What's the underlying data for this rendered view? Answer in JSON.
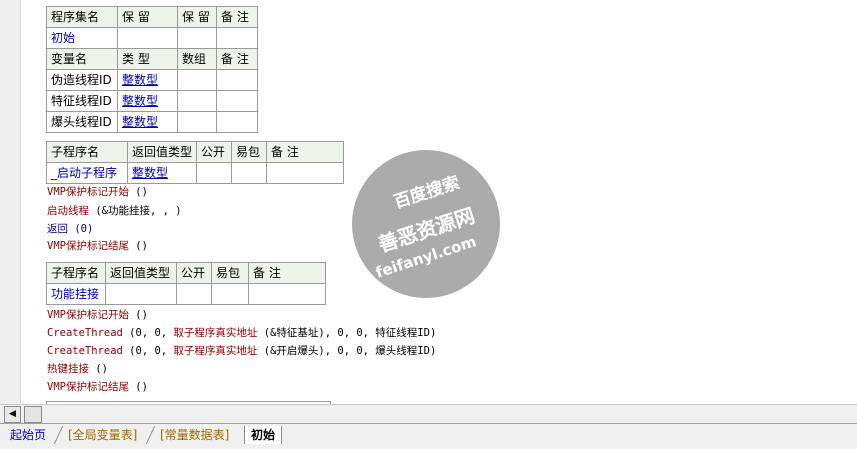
{
  "assembly_table": {
    "header": [
      "程序集名",
      "保 留",
      "保 留",
      "备 注"
    ],
    "name": "初始",
    "var_header": [
      "变量名",
      "类 型",
      "数组",
      "备 注"
    ],
    "vars": [
      {
        "name": "伪造线程ID",
        "type": "整数型"
      },
      {
        "name": "特征线程ID",
        "type": "整数型"
      },
      {
        "name": "爆头线程ID",
        "type": "整数型"
      }
    ]
  },
  "sub1": {
    "header": [
      "子程序名",
      "返回值类型",
      "公开",
      "易包",
      "备 注"
    ],
    "name": "_启动子程序",
    "return_type": "整数型"
  },
  "code1": [
    {
      "kw": "VMP保护标记开始",
      "args": " ()"
    },
    {
      "kw": "启动线程",
      "args": " (&功能挂接, , )"
    },
    {
      "kw": "返回",
      "args": " (0)"
    },
    {
      "kw": "VMP保护标记结尾",
      "args": " ()"
    }
  ],
  "sub2": {
    "header": [
      "子程序名",
      "返回值类型",
      "公开",
      "易包",
      "备 注"
    ],
    "name": "功能挂接"
  },
  "code2": [
    {
      "kw": "VMP保护标记开始",
      "args": " ()"
    },
    {
      "kw": "CreateThread",
      "args": " (0, 0, ",
      "fn": "取子程序真实地址",
      "rest": " (&特征基址), 0, 0, 特征线程ID)"
    },
    {
      "kw": "CreateThread",
      "args": " (0, 0, ",
      "fn": "取子程序真实地址",
      "rest": " (&开启爆头), 0, 0, 爆头线程ID)"
    },
    {
      "kw": "热键挂接",
      "args": " ()"
    },
    {
      "kw": "VMP保护标记结尾",
      "args": " ()"
    }
  ],
  "tabs": [
    "起始页",
    "[全局变量表]",
    "[常量数据表]",
    "初始"
  ],
  "watermark": {
    "line1": "百度搜索",
    "line2": "善恶资源网",
    "line3": "feifanyl.com"
  }
}
